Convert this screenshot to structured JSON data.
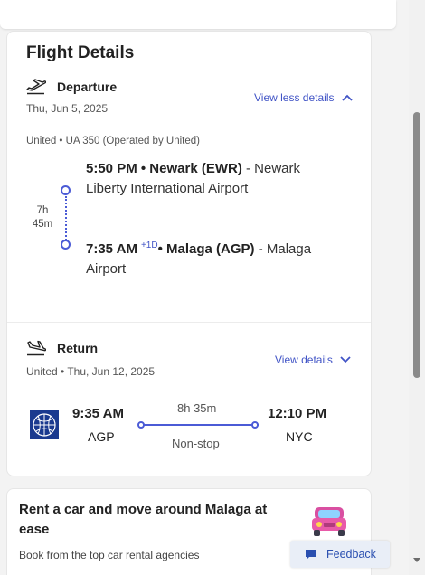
{
  "details": {
    "title": "Flight Details",
    "departure": {
      "label": "Departure",
      "date": "Thu, Jun 5, 2025",
      "toggle_label": "View less details",
      "operator": "United • UA 350 (Operated by United)",
      "duration_hours": "7h",
      "duration_minutes": "45m",
      "origin_time": "5:50 PM",
      "origin_airport": "• Newark (EWR)",
      "origin_name": " - Newark Liberty International Airport",
      "dest_time": "7:35 AM",
      "day_offset": "+1D",
      "dest_airport": "• Malaga (AGP)",
      "dest_name": " - Malaga Airport"
    },
    "return": {
      "label": "Return",
      "date": "United • Thu, Jun 12, 2025",
      "toggle_label": "View details",
      "depart_time": "9:35 AM",
      "depart_code": "AGP",
      "duration": "8h 35m",
      "stops": "Non-stop",
      "arrive_time": "12:10 PM",
      "arrive_code": "NYC"
    }
  },
  "promo": {
    "title": "Rent a car and move around Malaga at ease",
    "subtitle": "Book from the top car rental agencies",
    "icon": "car-icon"
  },
  "feedback": {
    "label": "Feedback"
  },
  "colors": {
    "accent": "#4154c6",
    "united_blue": "#1a3a8f"
  }
}
